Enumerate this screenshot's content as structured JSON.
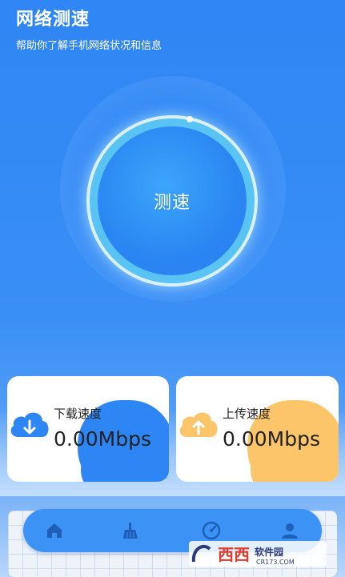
{
  "header": {
    "title": "网络测速",
    "subtitle": "帮助你了解手机网络状况和信息"
  },
  "gauge": {
    "button_label": "测速"
  },
  "cards": {
    "download": {
      "label": "下载速度",
      "value": "0.00Mbps",
      "icon": "cloud-download-icon",
      "accent": "#2d86f3"
    },
    "upload": {
      "label": "上传速度",
      "value": "0.00Mbps",
      "icon": "cloud-upload-icon",
      "accent": "#fdc56a"
    }
  },
  "nav": {
    "items": [
      {
        "icon": "home-icon"
      },
      {
        "icon": "broom-icon"
      },
      {
        "icon": "speedometer-icon"
      },
      {
        "icon": "user-icon"
      }
    ],
    "color": "#3d92f6"
  },
  "watermark": {
    "brand": "西西软件园",
    "site": "CR173.COM"
  },
  "colors": {
    "primary": "#2f86f4",
    "accent_yellow": "#fdc56a"
  }
}
